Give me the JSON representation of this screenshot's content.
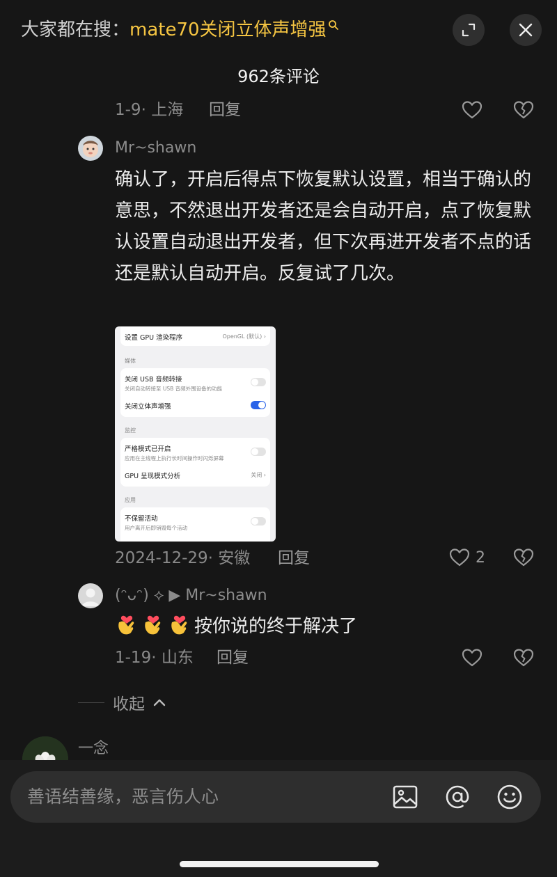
{
  "header": {
    "search_prefix": "大家都在搜：",
    "search_query": "mate70关闭立体声增强",
    "comment_count": "962条评论"
  },
  "comments": [
    {
      "date_location": "1-9· 上海",
      "reply_label": "回复"
    },
    {
      "username": "Mr~shawn",
      "text": "确认了，开启后得点下恢复默认设置，相当于确认的意思，不然退出开发者还是会自动开启，点了恢复默认设置自动退出开发者，但下次再进开发者不点的话还是默认自动开启。反复试了几次。",
      "date_location": "2024-12-29· 安徽",
      "reply_label": "回复",
      "like_count": "2",
      "screenshot": {
        "gpu_renderer_label": "设置 GPU 渲染程序",
        "gpu_renderer_value": "OpenGL (默认)",
        "section_media": "媒体",
        "usb_audio_title": "关闭 USB 音频转接",
        "usb_audio_sub": "关闭自动转接至 USB 音频外围设备的功能",
        "stereo_title": "关闭立体声增强",
        "section_monitor": "监控",
        "strict_title": "严格模式已开启",
        "strict_sub": "应用在主线程上执行长时间操作时闪烁屏幕",
        "gpu_profile_title": "GPU 呈现模式分析",
        "gpu_profile_value": "关闭",
        "section_apps": "应用",
        "no_keep_title": "不保留活动",
        "no_keep_sub": "用户离开后即销毁每个活动",
        "usb_audio_on": false,
        "stereo_on": true,
        "strict_on": false,
        "no_keep_on": false
      }
    },
    {
      "username": "(ᵔᴗᵔ) ⟡ ▶ Mr~shawn",
      "text": "按你说的终于解决了",
      "date_location": "1-19· 山东",
      "reply_label": "回复"
    }
  ],
  "collapse_label": "收起",
  "next_comment": {
    "username": "一念"
  },
  "input": {
    "placeholder": "善语结善缘，恶言伤人心"
  },
  "colors": {
    "background": "#161616",
    "accent_query": "#f5c542",
    "toggle_on": "#2a63e8"
  },
  "icons": [
    "search-icon",
    "expand-icon",
    "close-icon",
    "heart-icon",
    "broken-heart-icon",
    "image-icon",
    "at-icon",
    "smile-icon",
    "heart-hands-emoji",
    "chevron-up-icon"
  ]
}
